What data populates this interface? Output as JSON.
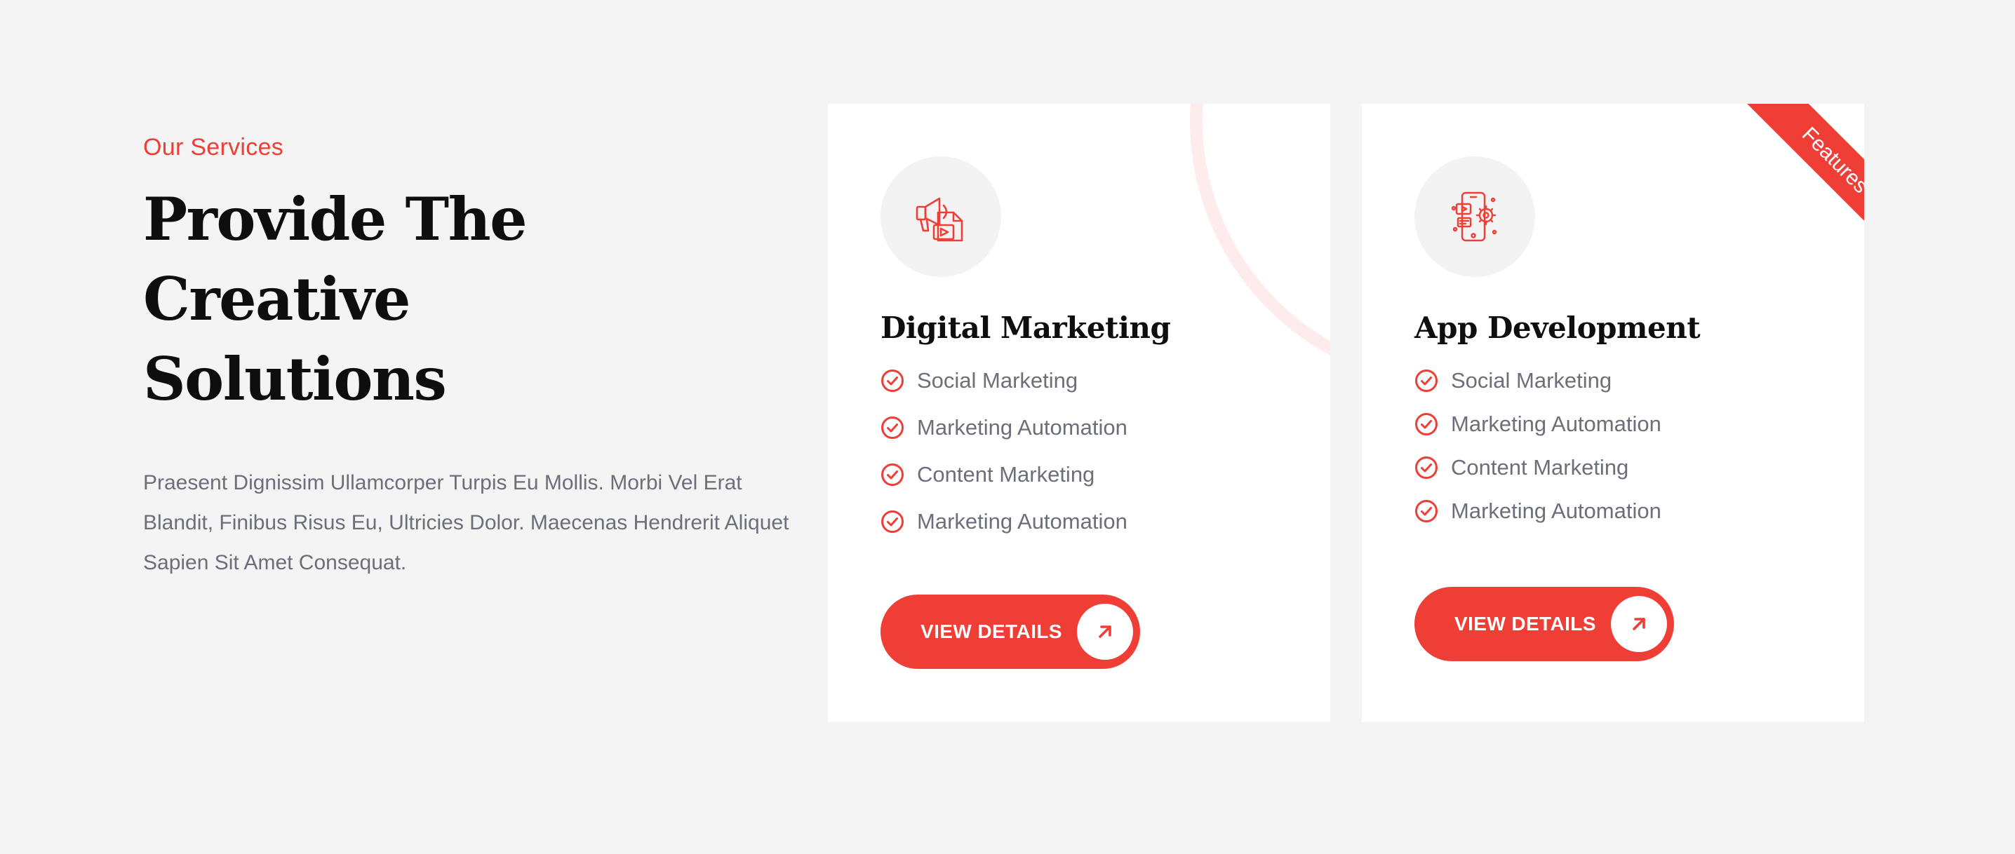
{
  "section": {
    "eyebrow": "Our Services",
    "heading_line1": "Provide The Creative",
    "heading_line2": "Solutions",
    "description": "Praesent Dignissim Ullamcorper Turpis Eu Mollis. Morbi Vel Erat Blandit, Finibus Risus Eu, Ultricies Dolor. Maecenas Hendrerit Aliquet Sapien Sit Amet Consequat."
  },
  "cards": [
    {
      "icon": "megaphone-media-icon",
      "title": "Digital Marketing",
      "features": [
        "Social Marketing",
        "Marketing Automation",
        "Content Marketing",
        "Marketing Automation"
      ],
      "button_label": "VIEW DETAILS"
    },
    {
      "icon": "mobile-app-gear-icon",
      "title": "App Development",
      "ribbon": "Features",
      "features": [
        "Social Marketing",
        "Marketing Automation",
        "Content Marketing",
        "Marketing Automation"
      ],
      "button_label": "VIEW DETAILS"
    }
  ],
  "colors": {
    "accent": "#ef3e36",
    "background": "#f4f4f4",
    "card": "#ffffff",
    "heading": "#0e0e0e",
    "body_text": "#6c6f7a"
  }
}
